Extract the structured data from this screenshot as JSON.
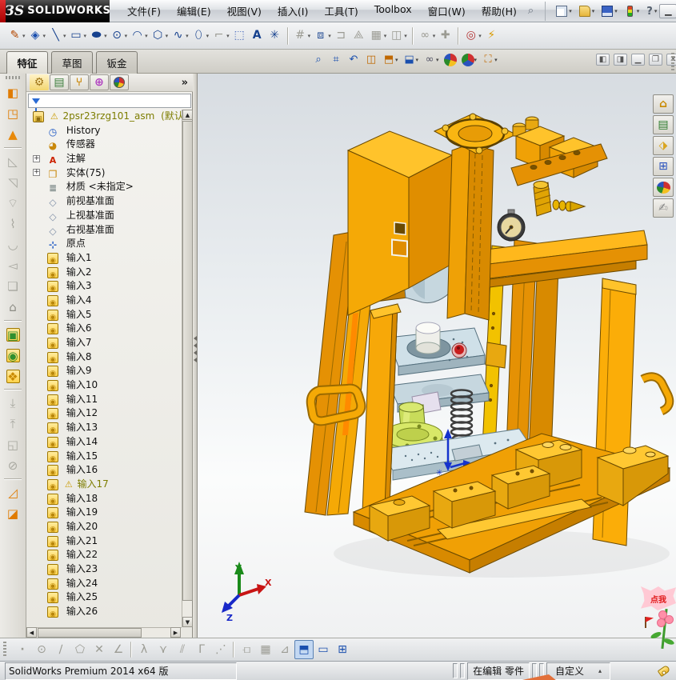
{
  "window": {
    "logo_mark": "ЗS",
    "logo_name": "SOLIDWORKS",
    "menus": [
      "文件(F)",
      "编辑(E)",
      "视图(V)",
      "插入(I)",
      "工具(T)",
      "Toolbox",
      "窗口(W)",
      "帮助(H)"
    ],
    "minimize": "▁",
    "restore": "❐",
    "close": "✕"
  },
  "quick_access": {
    "items": [
      {
        "n": "new-file-button",
        "cls": "qa-new",
        "a": "▾"
      },
      {
        "n": "open-file-button",
        "cls": "qa-open",
        "a": "▾"
      },
      {
        "n": "save-button",
        "cls": "qa-save",
        "a": "▾"
      },
      {
        "n": "xpress-products-button",
        "cls": "qa-light",
        "a": "▾"
      },
      {
        "n": "help-button",
        "cls": "qa-help",
        "g": "?",
        "a": "▾"
      }
    ]
  },
  "sketch_toolbar": {
    "items": [
      {
        "n": "sketch-tool",
        "g": "✎",
        "st": "color:#b34700",
        "a": "▾"
      },
      {
        "n": "smart-dimension-tool",
        "g": "◈",
        "st": "color:#1a4fae",
        "a": "▾"
      },
      {
        "n": "line-tool",
        "g": "╲",
        "st": "color:#16418e",
        "a": "▾"
      },
      {
        "n": "rectangle-tool",
        "g": "▭",
        "st": "color:#16418e",
        "a": "▾"
      },
      {
        "n": "slot-tool",
        "g": "⬬",
        "st": "color:#16418e",
        "a": "▾"
      },
      {
        "n": "circle-tool",
        "g": "⊙",
        "st": "color:#16418e",
        "a": "▾"
      },
      {
        "n": "arc-tool",
        "g": "◠",
        "st": "color:#16418e",
        "a": "▾"
      },
      {
        "n": "polygon-tool",
        "g": "⬡",
        "st": "color:#16418e",
        "a": "▾"
      },
      {
        "n": "spline-tool",
        "g": "∿",
        "st": "color:#16418e",
        "a": "▾"
      },
      {
        "n": "ellipse-tool",
        "g": "⬯",
        "st": "color:#16418e",
        "a": "▾"
      },
      {
        "n": "sketch-fillet-tool",
        "g": "⌐",
        "st": "color:#9b9b93",
        "a": "▾"
      },
      {
        "n": "convert-sketch-tool",
        "g": "⬚",
        "st": "color:#4a6bbd",
        "a": ""
      },
      {
        "n": "text-tool",
        "g": "A",
        "st": "color:#16418e;font-weight:bold",
        "a": ""
      },
      {
        "n": "equation-tool",
        "g": "✳",
        "st": "color:#16418e",
        "a": ""
      },
      {
        "n": "separator",
        "k": "sep",
        "g": "",
        "st": "",
        "a": "",
        "it": "false"
      },
      {
        "n": "trim-entities-tool",
        "g": "#",
        "st": "color:#9b9b93",
        "a": "▾"
      },
      {
        "n": "convert-entities-tool",
        "g": "⧈",
        "st": "color:#16418e",
        "a": "▾"
      },
      {
        "n": "offset-entities-tool",
        "g": "⊐",
        "st": "color:#9b9b93",
        "a": ""
      },
      {
        "n": "mirror-entities-tool",
        "g": "⟁",
        "st": "color:#9b9b93",
        "a": ""
      },
      {
        "n": "linear-sketch-pattern-tool",
        "g": "▦",
        "st": "color:#9b9b93",
        "a": "▾"
      },
      {
        "n": "move-entities-tool",
        "g": "◫",
        "st": "color:#9b9b93",
        "a": "▾"
      },
      {
        "n": "separator",
        "k": "sep",
        "g": "",
        "st": "",
        "a": "",
        "it": "false"
      },
      {
        "n": "display-relations-tool",
        "g": "∞",
        "st": "color:#9b9b93",
        "a": "▾"
      },
      {
        "n": "repair-sketch-tool",
        "g": "✚",
        "st": "color:#9b9b93",
        "a": ""
      },
      {
        "n": "separator",
        "k": "sep",
        "g": "",
        "st": "",
        "a": "",
        "it": "false"
      },
      {
        "n": "quick-snaps-tool",
        "g": "◎",
        "st": "color:#b33333",
        "a": "▾"
      },
      {
        "n": "rapid-sketch-tool",
        "g": "⚡",
        "st": "color:#d99a00",
        "a": ""
      }
    ]
  },
  "command_tabs": {
    "items": [
      {
        "label": "特征",
        "active": "1"
      },
      {
        "label": "草图",
        "active": "0"
      },
      {
        "label": "钣金",
        "active": "0"
      }
    ]
  },
  "headsup": {
    "items": [
      {
        "n": "zoom-to-fit-button",
        "g": "⌕",
        "st": "color:#1a4fae",
        "a": ""
      },
      {
        "n": "zoom-to-area-button",
        "g": "⌗",
        "st": "color:#1a4fae",
        "a": ""
      },
      {
        "n": "previous-view-button",
        "g": "↶",
        "st": "color:#1a4fae",
        "a": ""
      },
      {
        "n": "section-view-button",
        "g": "◫",
        "st": "color:#c06800",
        "a": ""
      },
      {
        "n": "view-orientation-button",
        "g": "⬒",
        "st": "color:#c06800",
        "a": "▾"
      },
      {
        "n": "display-style-button",
        "g": "⬓",
        "st": "color:#1a4fae",
        "a": "▾"
      },
      {
        "n": "hide-show-items-button",
        "g": "∞",
        "st": "color:#556",
        "a": "▾"
      },
      {
        "n": "edit-appearance-button",
        "g": "",
        "st": "background:conic-gradient(#d03030 0 30%,#f4c020 0 55%,#2a8a2a 0 78%,#2a52be 0);border-radius:50%",
        "a": ""
      },
      {
        "n": "apply-scene-button",
        "g": "",
        "st": "background:conic-gradient(#d03030 0 33%,#2a52be 0 66%,#2a8a2a 0);border-radius:50%",
        "a": "▾"
      },
      {
        "n": "view-settings-button",
        "g": "⛶",
        "st": "color:#c06800",
        "a": "▾"
      }
    ]
  },
  "mdi": {
    "items": [
      {
        "n": "pane-split-left-button",
        "g": "◧"
      },
      {
        "n": "pane-split-right-button",
        "g": "◨"
      },
      {
        "n": "minimize-document-button",
        "g": "▁"
      },
      {
        "n": "restore-document-button",
        "g": "❐"
      },
      {
        "n": "close-document-button",
        "g": "✕"
      }
    ]
  },
  "pane_header": {
    "items": [
      {
        "n": "featuremanager-tab",
        "g": "⚙",
        "st": "color:#a0761a"
      },
      {
        "n": "propertymanager-tab",
        "g": "▤",
        "st": "color:#3a7d3a"
      },
      {
        "n": "configurationmanager-tab",
        "g": "⑂",
        "st": "color:#c9880a;font-weight:bold"
      },
      {
        "n": "dimxpertmanager-tab",
        "g": "⊕",
        "st": "color:#b040c0;font-weight:bold"
      },
      {
        "n": "displaymanager-tab",
        "g": "",
        "st": ""
      }
    ],
    "overflow": "»"
  },
  "filter": {
    "placeholder": ""
  },
  "tree": {
    "root_label": "2psr23rzg101_asm",
    "root_suffix": "(默认",
    "root_warning": "⚠",
    "items": [
      {
        "icon": "history",
        "label": "History"
      },
      {
        "icon": "sensors",
        "label": "传感器"
      },
      {
        "icon": "annotations",
        "label": "注解",
        "exp": "1"
      },
      {
        "icon": "solids",
        "label": "实体(75)",
        "exp": "1"
      },
      {
        "icon": "material",
        "label": "材质 <未指定>"
      },
      {
        "icon": "plane",
        "label": "前视基准面"
      },
      {
        "icon": "plane",
        "label": "上视基准面"
      },
      {
        "icon": "plane",
        "label": "右视基准面"
      },
      {
        "icon": "origin",
        "label": "原点"
      },
      {
        "icon": "import",
        "label": "输入1"
      },
      {
        "icon": "import",
        "label": "输入2"
      },
      {
        "icon": "import",
        "label": "输入3"
      },
      {
        "icon": "import",
        "label": "输入4"
      },
      {
        "icon": "import",
        "label": "输入5"
      },
      {
        "icon": "import",
        "label": "输入6"
      },
      {
        "icon": "import",
        "label": "输入7"
      },
      {
        "icon": "import",
        "label": "输入8"
      },
      {
        "icon": "import",
        "label": "输入9"
      },
      {
        "icon": "import",
        "label": "输入10"
      },
      {
        "icon": "import",
        "label": "输入11"
      },
      {
        "icon": "import",
        "label": "输入12"
      },
      {
        "icon": "import",
        "label": "输入13"
      },
      {
        "icon": "import",
        "label": "输入14"
      },
      {
        "icon": "import",
        "label": "输入15"
      },
      {
        "icon": "import",
        "label": "输入16"
      },
      {
        "icon": "import",
        "label": "输入17",
        "warn": "⚠",
        "st": "color:#7d7d00"
      },
      {
        "icon": "import",
        "label": "输入18"
      },
      {
        "icon": "import",
        "label": "输入19"
      },
      {
        "icon": "import",
        "label": "输入20"
      },
      {
        "icon": "import",
        "label": "输入21"
      },
      {
        "icon": "import",
        "label": "输入22"
      },
      {
        "icon": "import",
        "label": "输入23"
      },
      {
        "icon": "import",
        "label": "输入24"
      },
      {
        "icon": "import",
        "label": "输入25"
      },
      {
        "icon": "import",
        "label": "输入26"
      }
    ]
  },
  "left_toolbar": {
    "items": [
      {
        "n": "base-flange-tool",
        "g": "◧",
        "st": "color:#e07b00"
      },
      {
        "n": "convert-to-sheetmetal-tool",
        "g": "◳",
        "st": "color:#e07b00"
      },
      {
        "n": "lofted-bend-tool",
        "g": "▲",
        "st": "color:#e8890a"
      },
      {
        "n": "separator",
        "k": "sep",
        "g": "",
        "st": "",
        "it": "false"
      },
      {
        "n": "sketched-bend-tool",
        "g": "◺",
        "st": "color:#a8a8a0"
      },
      {
        "n": "closed-corner-tool",
        "g": "◹",
        "st": "color:#a8a8a0"
      },
      {
        "n": "edge-flange-tool",
        "g": "⌔",
        "st": "color:#a8a8a0"
      },
      {
        "n": "miter-flange-tool",
        "g": "⌇",
        "st": "color:#a8a8a0"
      },
      {
        "n": "hem-tool",
        "g": "◡",
        "st": "color:#a8a8a0"
      },
      {
        "n": "jog-tool",
        "g": "◅",
        "st": "color:#a8a8a0"
      },
      {
        "n": "corner-relief-tool",
        "g": "❏",
        "st": "color:#a8a8a0"
      },
      {
        "n": "forming-tool-lock",
        "g": "⌂",
        "st": "color:#8c8c84"
      },
      {
        "n": "separator",
        "k": "sep",
        "g": "",
        "st": "",
        "it": "false"
      },
      {
        "n": "extruded-cut-tool",
        "g": "▣",
        "st": "background:linear-gradient(#ffe9a0,#ffd24a);color:#2f8f2f;border:1px solid #a07800"
      },
      {
        "n": "simple-hole-tool",
        "g": "◉",
        "st": "background:linear-gradient(#ffe9a0,#ffd24a);color:#2f8f2f;border:1px solid #a07800"
      },
      {
        "n": "vent-tool",
        "g": "❖",
        "st": "background:linear-gradient(#ffe9a0,#ffd24a);color:#c98a00;border:1px solid #a07800"
      },
      {
        "n": "separator",
        "k": "sep",
        "g": "",
        "st": "",
        "it": "false"
      },
      {
        "n": "unfold-tool",
        "g": "⤓",
        "st": "color:#a8a8a0"
      },
      {
        "n": "fold-tool",
        "g": "⤒",
        "st": "color:#a8a8a0"
      },
      {
        "n": "flatten-tool",
        "g": "◱",
        "st": "color:#a8a8a0"
      },
      {
        "n": "no-bends-tool",
        "g": "⊘",
        "st": "color:#a8a8a0"
      },
      {
        "n": "separator",
        "k": "sep",
        "g": "",
        "st": "",
        "it": "false"
      },
      {
        "n": "rip-tool",
        "g": "◿",
        "st": "color:#e07b00"
      },
      {
        "n": "insert-bends-tool",
        "g": "◪",
        "st": "color:#e07b00"
      }
    ]
  },
  "task_pane": {
    "items": [
      {
        "n": "home-tab",
        "g": "⌂",
        "st": "color:#c98a00;font-weight:bold"
      },
      {
        "n": "design-library-tab",
        "g": "▤",
        "st": "color:#2a7a2a"
      },
      {
        "n": "file-explorer-tab",
        "g": "⬗",
        "st": "color:#d9a520"
      },
      {
        "n": "view-palette-tab",
        "g": "⊞",
        "st": "color:#2a52be"
      },
      {
        "n": "appearances-tab",
        "g": "",
        "st": "background:conic-gradient(#d03030 0 30%,#f4c020 0 55%,#2a8a2a 0 78%,#2a52be 0);border-radius:50%;width:15px;height:15px"
      },
      {
        "n": "custom-properties-tab",
        "g": "✍",
        "st": "color:#888"
      }
    ]
  },
  "bottom_toolbar": {
    "items": [
      {
        "n": "point-snap",
        "g": "·",
        "st": "color:#9b9b93;font-weight:bold"
      },
      {
        "n": "center-snap",
        "g": "⊙",
        "st": "color:#9b9b93"
      },
      {
        "n": "line-snap",
        "g": "∕",
        "st": "color:#9b9b93"
      },
      {
        "n": "polygon-snap",
        "g": "⬠",
        "st": "color:#9b9b93"
      },
      {
        "n": "intersection-snap",
        "g": "✕",
        "st": "color:#9b9b93"
      },
      {
        "n": "angle-snap",
        "g": "∠",
        "st": "color:#9b9b93"
      },
      {
        "n": "separator",
        "k": "sep",
        "g": "",
        "st": "",
        "it": "false"
      },
      {
        "n": "tangent-snap",
        "g": "λ",
        "st": "color:#9b9b93"
      },
      {
        "n": "midpoint-snap",
        "g": "⋎",
        "st": "color:#9b9b93"
      },
      {
        "n": "parallel-snap",
        "g": "⫽",
        "st": "color:#9b9b93"
      },
      {
        "n": "perpendicular-snap",
        "g": "Γ",
        "st": "color:#9b9b93"
      },
      {
        "n": "point-chain-snap",
        "g": "⋰",
        "st": "color:#9b9b93"
      },
      {
        "n": "separator",
        "k": "sep",
        "g": "",
        "st": "",
        "it": "false"
      },
      {
        "n": "length-snap",
        "g": "⟤",
        "st": "color:#9b9b93"
      },
      {
        "n": "grid-snap",
        "g": "▦",
        "st": "color:#9b9b93"
      },
      {
        "n": "angle-step-snap",
        "g": "⊿",
        "st": "color:#9b9b93"
      },
      {
        "n": "shaded-cube-view-button",
        "g": "⬒",
        "st": "color:#1a4fae",
        "p": "1"
      },
      {
        "n": "single-viewport-button",
        "g": "▭",
        "st": "color:#1a4fae"
      },
      {
        "n": "viewport-layout-button",
        "g": "⊞",
        "st": "color:#1a4fae"
      }
    ]
  },
  "status_bar": {
    "left_text": "SolidWorks Premium 2014 x64 版",
    "editing_text": "在编辑 零件",
    "custom_text": "自定义",
    "custom_arrow": "▴"
  },
  "triad": {
    "x": "X",
    "y": "Y",
    "z": "Z"
  },
  "overlay": {
    "bubble_text": "点我"
  },
  "colors": {
    "model_orange": "#F5A906",
    "model_orange_dark": "#D88A00",
    "model_yellow": "#FFC832",
    "plate_blue_gray": "#C6D7DF",
    "cylinder_green": "#C8DC5A",
    "button_red": "#C81E1E",
    "viewport_top": "#D7DCE1",
    "accent_blue": "#1533CC",
    "logo_red": "#CC0000"
  }
}
